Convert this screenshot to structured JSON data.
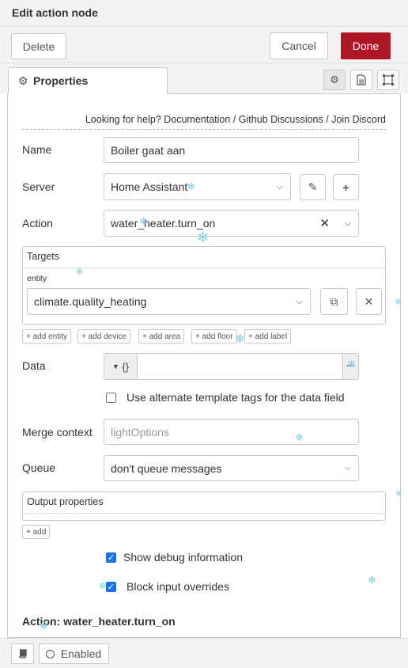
{
  "dialog": {
    "title": "Edit action node"
  },
  "toolbar": {
    "delete_label": "Delete",
    "cancel_label": "Cancel",
    "done_label": "Done"
  },
  "tabs": {
    "properties_label": "Properties"
  },
  "help": {
    "prefix": "Looking for help?",
    "documentation": "Documentation",
    "sep1": "/",
    "github": "Github Discussions",
    "sep2": "/",
    "discord": "Join Discord"
  },
  "form": {
    "name": {
      "label": "Name",
      "value": "Boiler gaat aan"
    },
    "server": {
      "label": "Server",
      "value": "Home Assistant"
    },
    "action": {
      "label": "Action",
      "value": "water_heater.turn_on"
    },
    "targets": {
      "title": "Targets",
      "entity_label": "entity",
      "entity_value": "climate.quality_heating",
      "add_buttons": [
        "add entity",
        "add device",
        "add area",
        "add floor",
        "add label"
      ]
    },
    "data": {
      "label": "Data",
      "type_symbol": "{}"
    },
    "alt_template": {
      "label": "Use alternate template tags for the data field",
      "checked": false
    },
    "merge_context": {
      "label": "Merge context",
      "placeholder": "lightOptions"
    },
    "queue": {
      "label": "Queue",
      "value": "don't queue messages"
    },
    "output": {
      "title": "Output properties",
      "add_label": "add"
    },
    "debug": {
      "label": "Show debug information",
      "checked": true
    },
    "block_input": {
      "label": "Block input overrides",
      "checked": true
    },
    "action_heading": "Action: water_heater.turn_on"
  },
  "footer": {
    "enabled_label": "Enabled"
  },
  "colors": {
    "done": "#ad1625",
    "checkbox": "#1a73e8",
    "snow": "#7fc9e8"
  }
}
